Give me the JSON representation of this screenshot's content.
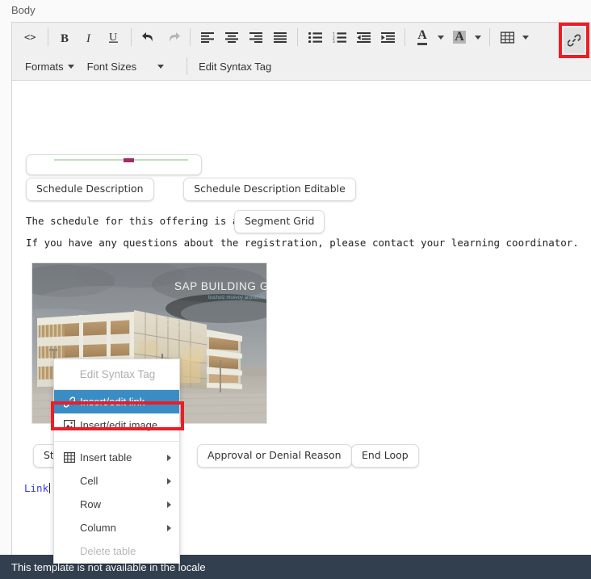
{
  "field": {
    "label": "Body"
  },
  "toolbar": {
    "row1": [
      {
        "name": "source-code-icon",
        "title": "Source code",
        "disabled": false
      },
      {
        "name": "bold-icon",
        "title": "Bold",
        "disabled": false
      },
      {
        "name": "italic-icon",
        "title": "Italic",
        "disabled": false
      },
      {
        "name": "underline-icon",
        "title": "Underline",
        "disabled": false
      },
      {
        "name": "undo-icon",
        "title": "Undo",
        "disabled": false
      },
      {
        "name": "redo-icon",
        "title": "Redo",
        "disabled": true
      },
      {
        "name": "align-left-icon",
        "title": "Align left",
        "disabled": false
      },
      {
        "name": "align-center-icon",
        "title": "Align center",
        "disabled": false
      },
      {
        "name": "align-right-icon",
        "title": "Align right",
        "disabled": false
      },
      {
        "name": "align-justify-icon",
        "title": "Justify",
        "disabled": false
      },
      {
        "name": "bullet-list-icon",
        "title": "Bullet list",
        "disabled": false
      },
      {
        "name": "numbered-list-icon",
        "title": "Numbered list",
        "disabled": false
      },
      {
        "name": "outdent-icon",
        "title": "Decrease indent",
        "disabled": false
      },
      {
        "name": "indent-icon",
        "title": "Increase indent",
        "disabled": false
      },
      {
        "name": "text-color-icon",
        "title": "Text color",
        "disabled": false
      },
      {
        "name": "background-color-icon",
        "title": "Background color",
        "disabled": false
      },
      {
        "name": "table-icon",
        "title": "Table",
        "disabled": false
      },
      {
        "name": "insert-edit-link-icon",
        "title": "Insert/edit link",
        "disabled": false
      }
    ],
    "formats_label": "Formats",
    "font_sizes_label": "Font Sizes",
    "edit_syntax_tag_label": "Edit Syntax Tag"
  },
  "content": {
    "pills_row1": [
      "Schedule Description",
      "Schedule Description Editable"
    ],
    "paragraph1": "The schedule for this offering is as follows:",
    "segment_grid_pill": "Segment Grid",
    "paragraph2": "If you have any questions about the registration, please contact your learning coordinator.",
    "image": {
      "name": "sap-building-galway-photo",
      "caption_main": "SAP BUILDING GALWAY",
      "caption_sub": "bucholz mcevoy architects"
    },
    "pills_row2": [
      "Star",
      "Approval or Denial Reason",
      "End Loop"
    ],
    "link_text": "Link"
  },
  "context_menu": {
    "header": "Edit Syntax Tag",
    "items": [
      {
        "label": "Insert/edit link",
        "icon": "link-icon",
        "selected": true,
        "submenu": false,
        "disabled": false
      },
      {
        "label": "Insert/edit image",
        "icon": "image-icon",
        "selected": false,
        "submenu": false,
        "disabled": false
      },
      {
        "label": "Insert table",
        "icon": "table-icon",
        "selected": false,
        "submenu": true,
        "disabled": false
      },
      {
        "label": "Cell",
        "icon": "",
        "selected": false,
        "submenu": true,
        "disabled": false
      },
      {
        "label": "Row",
        "icon": "",
        "selected": false,
        "submenu": true,
        "disabled": false
      },
      {
        "label": "Column",
        "icon": "",
        "selected": false,
        "submenu": true,
        "disabled": false
      },
      {
        "label": "Delete table",
        "icon": "",
        "selected": false,
        "submenu": false,
        "disabled": true
      }
    ]
  },
  "bottom_bar": {
    "text": "This template is not available in the locale"
  },
  "colors": {
    "highlight_red": "#ee1c24",
    "menu_selected_blue": "#3a8dc4",
    "bottom_bar": "#323f4e",
    "link_blue": "#3b3bdb"
  }
}
